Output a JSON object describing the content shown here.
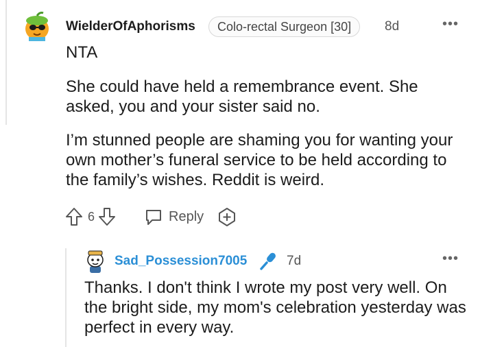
{
  "top_comment": {
    "username": "WielderOfAphorisms",
    "flair": "Colo-rectal Surgeon [30]",
    "time": "8d",
    "more_icon": "more-dots-icon",
    "paragraphs": [
      "NTA",
      "She could have held a remembrance event. She asked, you and your sister said no.",
      "I’m stunned people are shaming you for wanting your own mother’s funeral service to be held according to the family’s wishes. Reddit is weird."
    ],
    "actions": {
      "vote_count": "6",
      "reply_label": "Reply"
    }
  },
  "reply_comment": {
    "username": "Sad_Possession7005",
    "time": "7d",
    "more_icon": "more-dots-icon",
    "text": "Thanks. I don't think I wrote my post very well. On the bright side, my mom's celebration yesterday was perfect in every way."
  },
  "colors": {
    "username_reply": "#2b8fd6",
    "text": "#1c1c1c",
    "muted": "#555555",
    "divider": "#e4e4e4"
  }
}
